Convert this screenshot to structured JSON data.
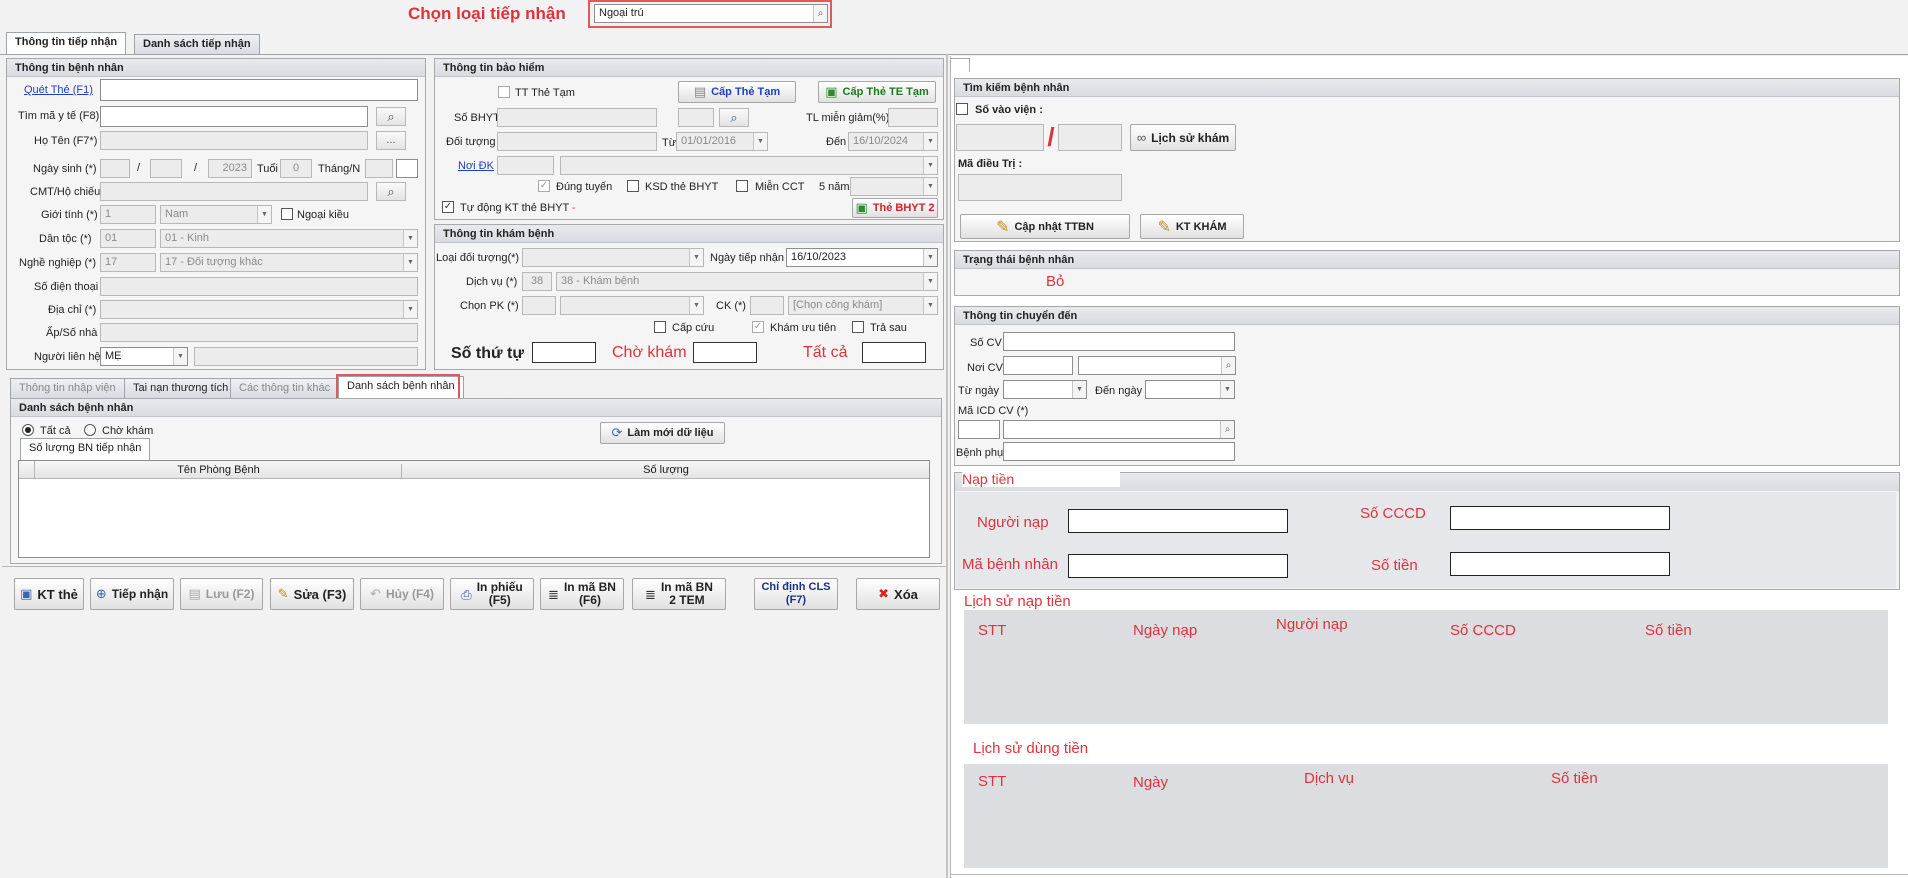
{
  "header": {
    "choose_type_label": "Chọn loại tiếp nhận",
    "choose_type_value": "Ngoại trú"
  },
  "main_tabs": [
    "Thông tin tiếp nhận",
    "Danh sách tiếp nhận"
  ],
  "patient_info": {
    "title": "Thông tin bệnh nhân",
    "scan_card": "Quét Thẻ (F1)",
    "find_code": "Tìm mã y tế (F8)",
    "name": "Họ Tên (F7*)",
    "name_btn": "...",
    "dob": "Ngày sinh (*)",
    "dob_sep": "/",
    "dob_year": "2023",
    "age": "Tuổi",
    "age_value": "0",
    "month": "Tháng/N",
    "id_card": "CMT/Hộ chiếu",
    "gender": "Giới tính (*)",
    "gender_code": "1",
    "gender_value": "Nam",
    "foreign": "Ngoại kiều",
    "ethnic": "Dân tộc (*)",
    "ethnic_code": "01",
    "ethnic_value": "01 - Kinh",
    "job": "Nghề nghiệp (*)",
    "job_code": "17",
    "job_value": "17 - Đối tượng khác",
    "phone": "Số điện thoại",
    "address": "Địa chỉ (*)",
    "hamlet": "Ấp/Số nhà",
    "contact": "Người liên hệ",
    "contact_value": "MẸ"
  },
  "insurance": {
    "title": "Thông tin bảo hiểm",
    "temp_card_chk": "TT Thẻ Tạm",
    "temp_card_btn": "Cấp Thẻ Tạm",
    "temp_te_btn": "Cấp Thẻ TE Tạm",
    "bhyt_no": "Số BHYT",
    "discount": "TL miễn giảm(%)",
    "subject": "Đối tượng",
    "from": "Từ",
    "from_value": "01/01/2016",
    "to": "Đến",
    "to_value": "16/10/2024",
    "reg_place": "Nơi ĐK",
    "correct_route": "Đúng tuyến",
    "ksd": "KSD thẻ BHYT",
    "exempt": "Miễn CCT",
    "five_years": "5 năm",
    "auto_check": "Tự động KT thẻ BHYT",
    "dash": "-",
    "card2_btn": "Thẻ BHYT 2"
  },
  "exam": {
    "title": "Thông tin khám bệnh",
    "subject_type": "Loại đối tượng(*)",
    "receive_date": "Ngày tiếp nhận",
    "receive_date_value": "16/10/2023",
    "service": "Dịch vụ (*)",
    "service_code": "38",
    "service_value": "38 - Khám bệnh",
    "room": "Chọn PK (*)",
    "ck": "CK (*)",
    "ck_value": "[Chọn công khám]",
    "emergency": "Cấp cứu",
    "priority": "Khám ưu tiên",
    "pay_later": "Trả sau",
    "queue_no": "Số thứ tự",
    "waiting": "Chờ khám",
    "all": "Tất cả"
  },
  "lower_tabs": [
    "Thông tin nhập viện",
    "Tai nạn thương tích",
    "Các thông tin khác",
    "Danh sách bệnh nhân"
  ],
  "patient_list": {
    "title": "Danh sách bệnh nhân",
    "radio_all": "Tất cả",
    "radio_waiting": "Chờ khám",
    "refresh": "Làm mới dữ liệu",
    "sub_tab": "Số lượng BN tiếp nhận",
    "columns": [
      "Tên Phòng Bệnh",
      "Số lượng"
    ]
  },
  "toolbar": {
    "kt_card": "KT thẻ",
    "receive": "Tiếp nhận",
    "save": "Lưu (F2)",
    "edit": "Sửa (F3)",
    "cancel": "Hủy (F4)",
    "print_1": "In phiếu",
    "print_2": "(F5)",
    "print_bn_1": "In mã BN",
    "print_bn_2": "(F6)",
    "print_tem_1": "In mã BN",
    "print_tem_2": "2 TEM",
    "cls_1": "Chỉ định CLS",
    "cls_2": "(F7)",
    "delete": "Xóa"
  },
  "search": {
    "title": "Tìm kiếm bệnh nhân",
    "admission_no": "Số vào viện :",
    "history": "Lịch sử khám",
    "treat_code": "Mã điều Trị :",
    "update_btn": "Cập nhật TTBN",
    "kt_exam_btn": "KT KHÁM"
  },
  "status": {
    "title": "Trạng thái bệnh nhân",
    "value": "Bỏ"
  },
  "transfer": {
    "title": "Thông tin chuyển đến",
    "cv_no": "Số CV",
    "cv_place": "Nơi CV",
    "from_date": "Từ ngày",
    "to_date": "Đến ngày",
    "icd": "Mã ICD CV (*)",
    "sub_disease": "Bệnh phụ"
  },
  "topup": {
    "title": "Nạp tiền",
    "payer": "Người nạp",
    "cccd": "Số CCCD",
    "patient_code": "Mã bệnh nhân",
    "amount": "Số tiền",
    "history_title": "Lịch sử nạp tiền",
    "history_cols": [
      "STT",
      "Ngày nạp",
      "Người nạp",
      "Số CCCD",
      "Số tiền"
    ],
    "usage_title": "Lịch sử dùng tiền",
    "usage_cols": [
      "STT",
      "Ngày",
      "Dịch vụ",
      "Số tiền"
    ]
  }
}
